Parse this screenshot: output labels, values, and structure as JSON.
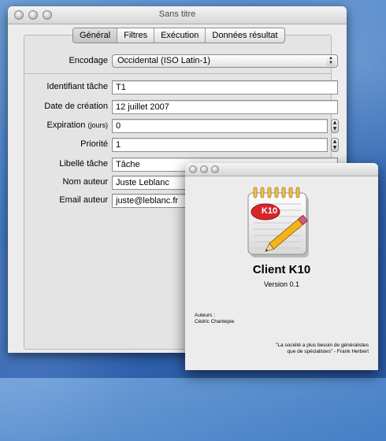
{
  "main_window": {
    "title": "Sans titre",
    "tabs": [
      "Général",
      "Filtres",
      "Exécution",
      "Données résultat"
    ],
    "encoding": {
      "label": "Encodage",
      "value": "Occidental (ISO Latin-1)"
    },
    "fields": {
      "task_id": {
        "label": "Identifiant tâche",
        "value": "T1"
      },
      "created": {
        "label": "Date de création",
        "value": "12 juillet 2007"
      },
      "expiration": {
        "label": "Expiration",
        "unit": "(jours)",
        "value": "0"
      },
      "priority": {
        "label": "Priorité",
        "value": "1"
      },
      "task_label": {
        "label": "Libellé tâche",
        "value": "Tâche"
      },
      "author_name": {
        "label": "Nom auteur",
        "value": "Juste Leblanc"
      },
      "author_email": {
        "label": "Email auteur",
        "value": "juste@leblanc.fr"
      }
    }
  },
  "about_window": {
    "icon_text": "K10",
    "app_name": "Client K10",
    "version": "Version 0.1",
    "authors_label": "Auteurs :",
    "author": "Cédric Chantepie",
    "quote_line1": "\"La société a plus besoin de généralistes",
    "quote_line2": "que de spécialistes\"  - Frank Herbert"
  },
  "icons": [
    "close-button",
    "minimize-button",
    "zoom-button",
    "select-arrows-icon",
    "stepper-icon",
    "notepad-pencil-icon"
  ]
}
